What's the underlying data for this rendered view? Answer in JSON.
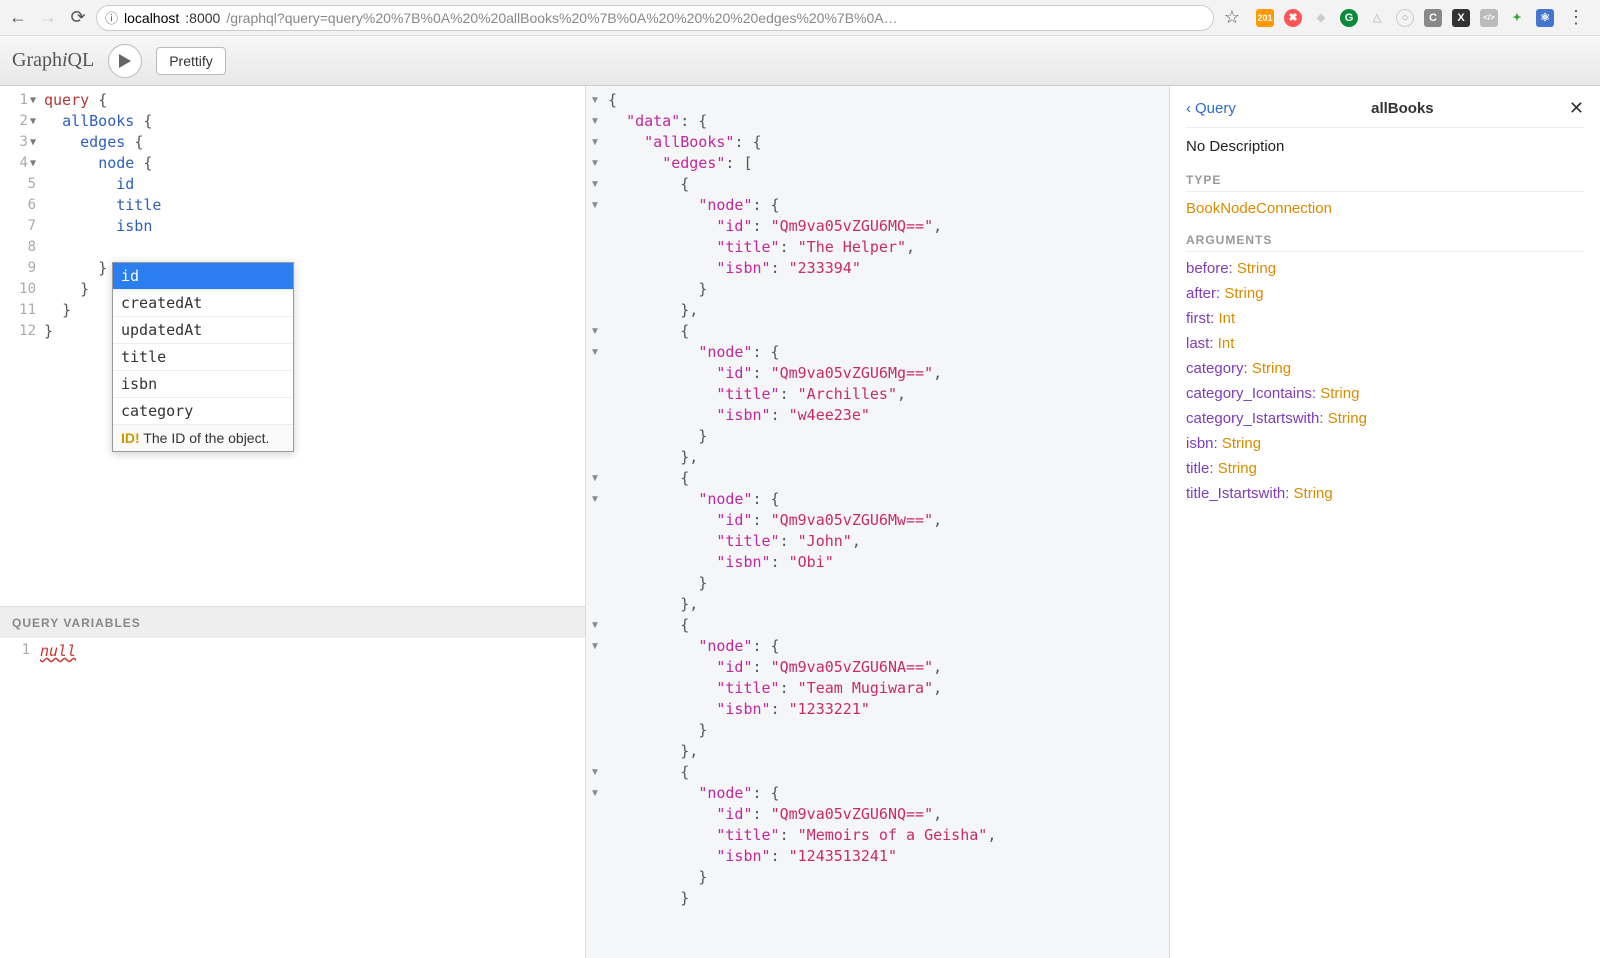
{
  "browser": {
    "url_info_icon": "ⓘ",
    "host": "localhost",
    "port": ":8000",
    "path": "/graphql?query=query%20%7B%0A%20%20allBooks%20%7B%0A%20%20%20%20edges%20%7B%0A…",
    "star": "☆",
    "badge_num": "201",
    "ext_labels": [
      "201",
      "",
      "",
      "G",
      "",
      "",
      "C",
      "X",
      "</>",
      "",
      "",
      ""
    ]
  },
  "toolbar": {
    "logo": "GraphiQL",
    "prettify": "Prettify"
  },
  "editor": {
    "lines": [
      "1",
      "2",
      "3",
      "4",
      "5",
      "6",
      "7",
      "8",
      "9",
      "10",
      "11",
      "12"
    ],
    "query_kw": "query",
    "allBooks": "allBooks",
    "edges": "edges",
    "node": "node",
    "id": "id",
    "title": "title",
    "isbn": "isbn"
  },
  "autocomplete": {
    "items": [
      "id",
      "createdAt",
      "updatedAt",
      "title",
      "isbn",
      "category"
    ],
    "selected": 0,
    "desc_type": "ID!",
    "desc_text": "  The ID of the object."
  },
  "vars": {
    "label": "QUERY VARIABLES",
    "value": "null",
    "line": "1"
  },
  "result": {
    "data": {
      "allBooks": {
        "edges": [
          {
            "node": {
              "id": "Qm9va05vZGU6MQ==",
              "title": "The Helper",
              "isbn": "233394"
            }
          },
          {
            "node": {
              "id": "Qm9va05vZGU6Mg==",
              "title": "Archilles",
              "isbn": "w4ee23e"
            }
          },
          {
            "node": {
              "id": "Qm9va05vZGU6Mw==",
              "title": "John",
              "isbn": "Obi"
            }
          },
          {
            "node": {
              "id": "Qm9va05vZGU6NA==",
              "title": "Team Mugiwara",
              "isbn": "1233221"
            }
          },
          {
            "node": {
              "id": "Qm9va05vZGU6NQ==",
              "title": "Memoirs of a Geisha",
              "isbn": "1243513241"
            }
          }
        ]
      }
    }
  },
  "docs": {
    "back": "Query",
    "current": "allBooks",
    "no_desc": "No Description",
    "type_label": "TYPE",
    "type_value": "BookNodeConnection",
    "args_label": "ARGUMENTS",
    "args": [
      {
        "name": "before",
        "type": "String"
      },
      {
        "name": "after",
        "type": "String"
      },
      {
        "name": "first",
        "type": "Int"
      },
      {
        "name": "last",
        "type": "Int"
      },
      {
        "name": "category",
        "type": "String"
      },
      {
        "name": "category_Icontains",
        "type": "String"
      },
      {
        "name": "category_Istartswith",
        "type": "String"
      },
      {
        "name": "isbn",
        "type": "String"
      },
      {
        "name": "title",
        "type": "String"
      },
      {
        "name": "title_Istartswith",
        "type": "String"
      }
    ]
  }
}
